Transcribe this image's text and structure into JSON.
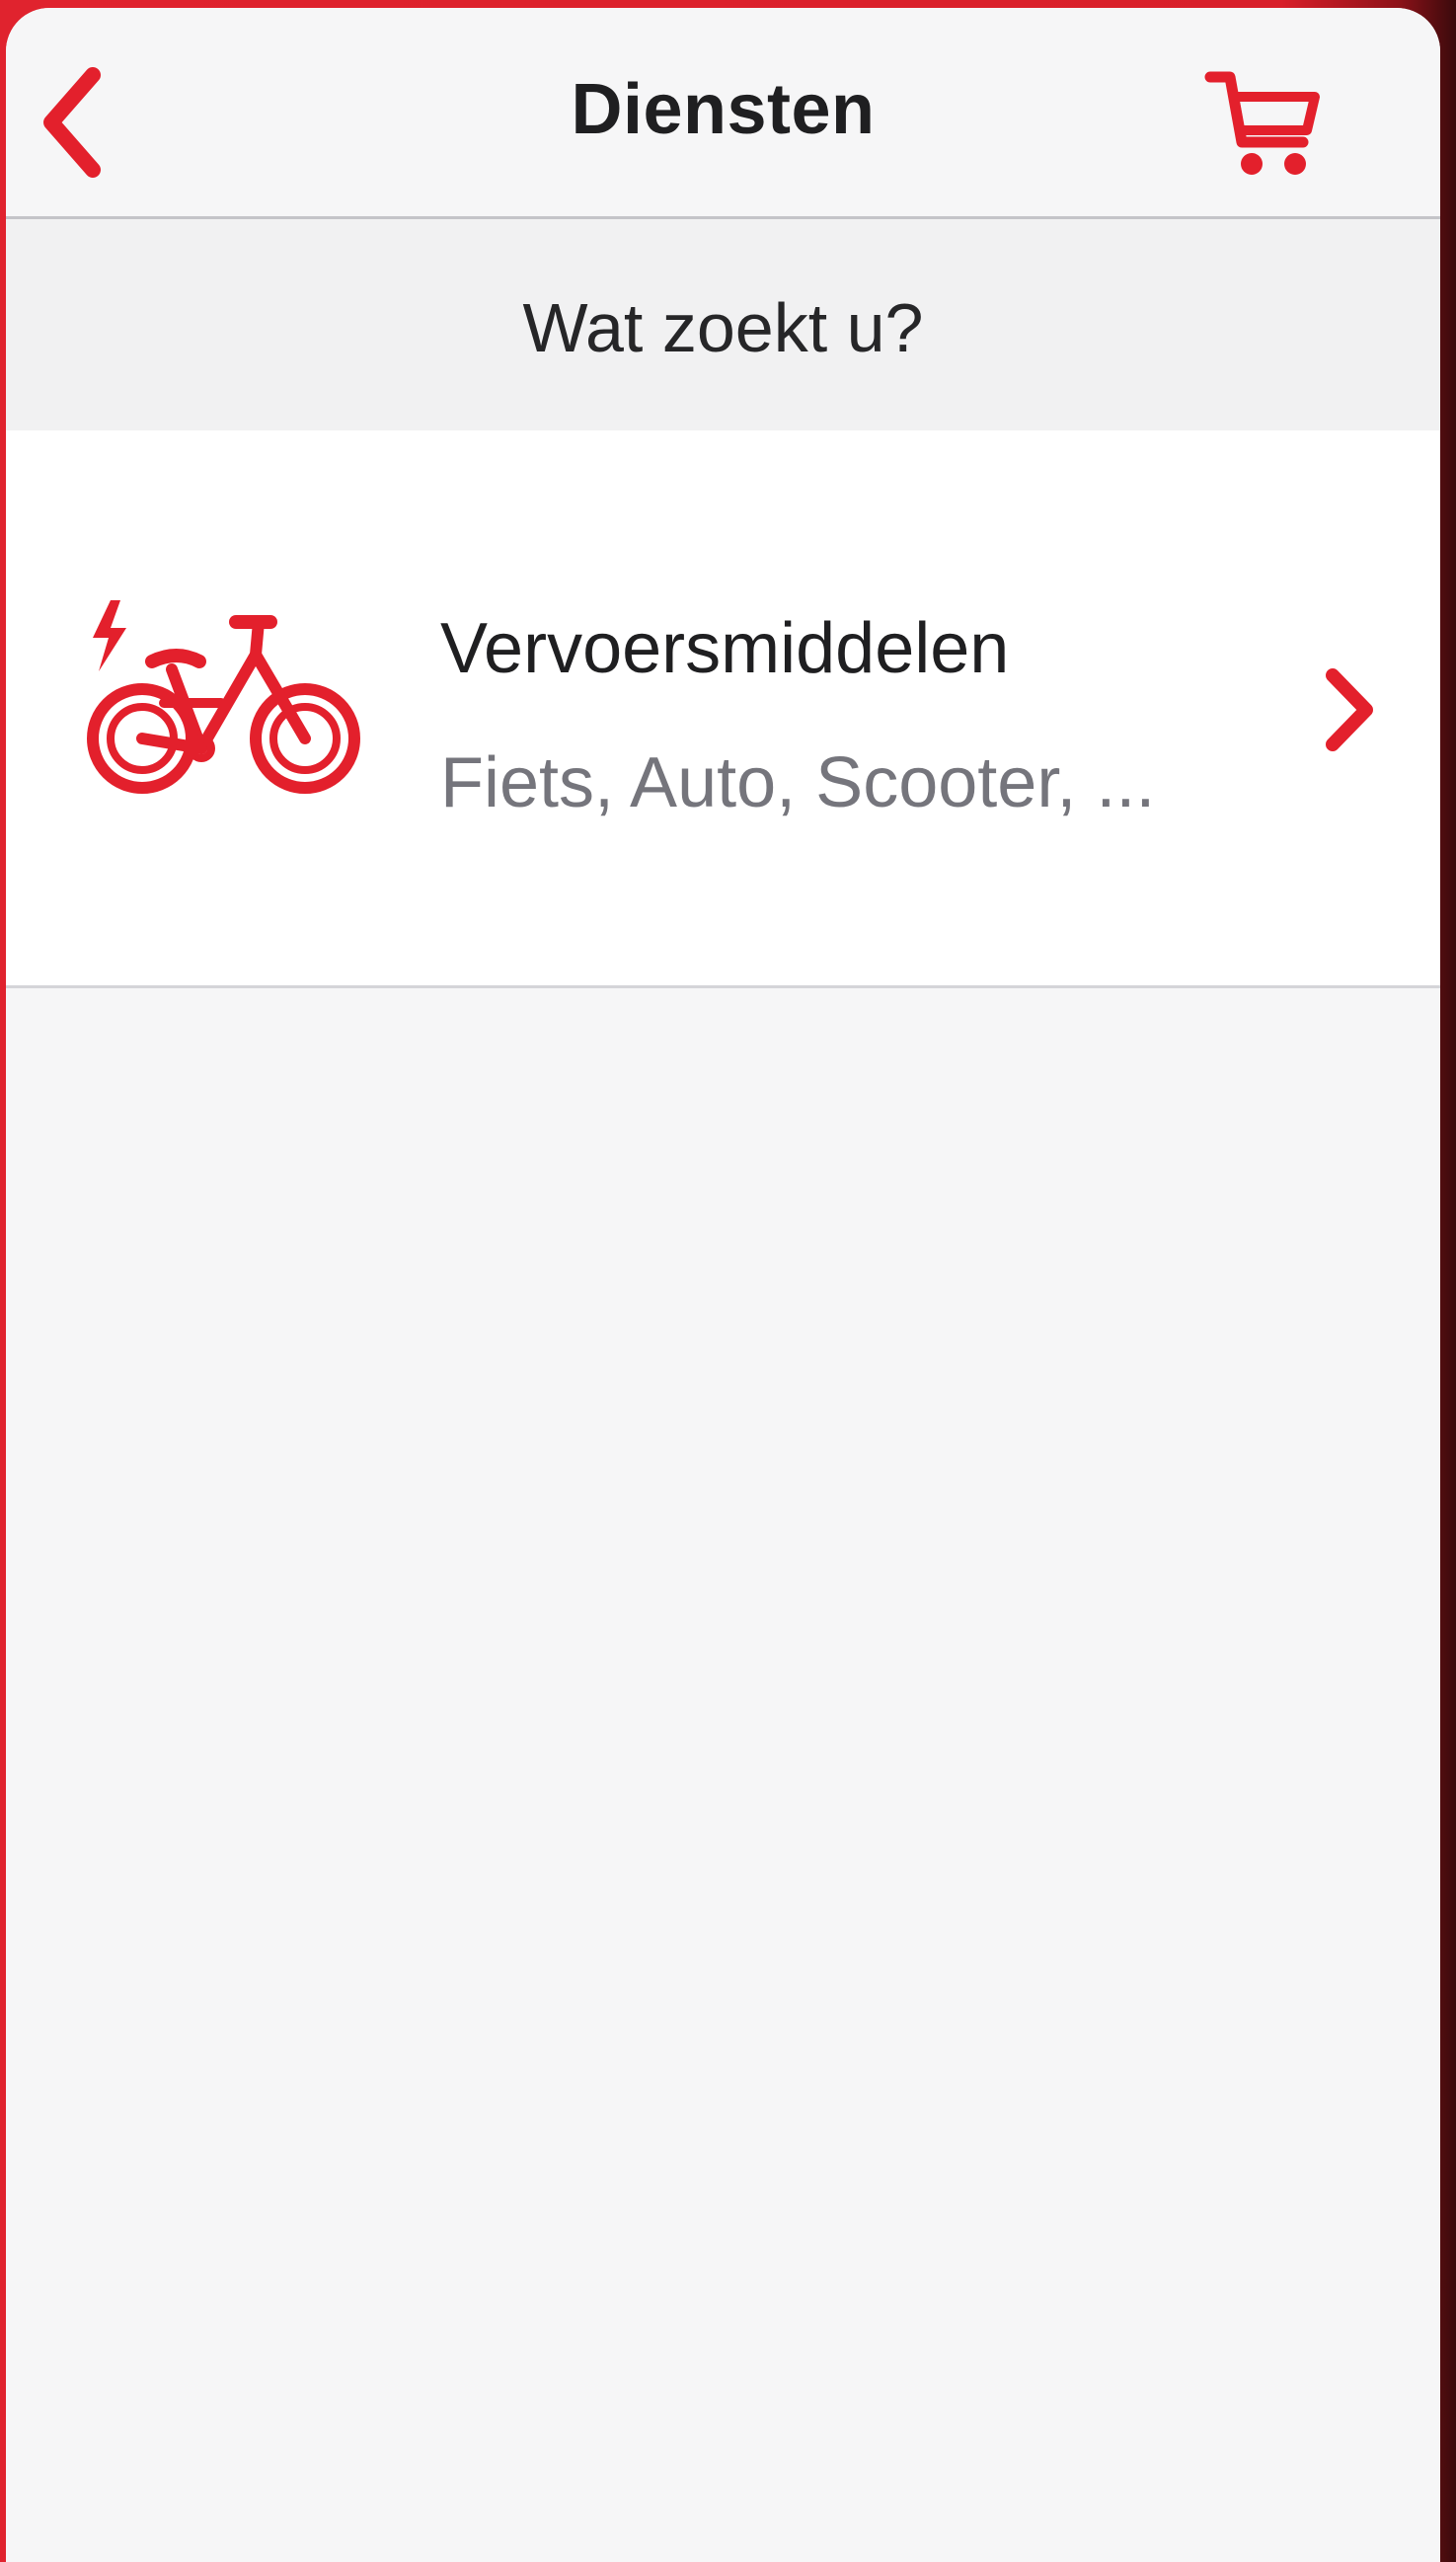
{
  "colors": {
    "accent": "#e3202c",
    "background": "#f6f6f7",
    "text_primary": "#1f1f21",
    "text_secondary": "#75757c"
  },
  "navbar": {
    "title": "Diensten",
    "back_icon": "chevron-left-icon",
    "cart_icon": "shopping-cart-icon"
  },
  "section": {
    "header": "Wat zoekt u?"
  },
  "list": {
    "items": [
      {
        "title": "Vervoersmiddelen",
        "subtitle": "Fiets, Auto, Scooter, ...",
        "icon": "electric-bike-icon",
        "chevron_icon": "chevron-right-icon"
      }
    ]
  }
}
